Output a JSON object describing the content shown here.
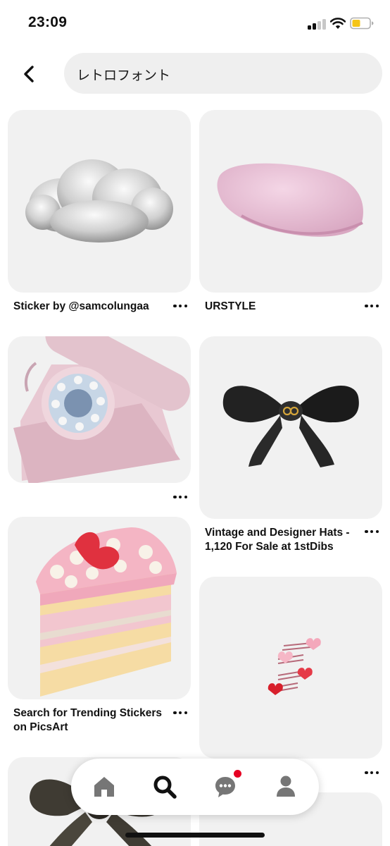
{
  "status": {
    "time": "23:09",
    "battery_color": "#f5c518"
  },
  "search": {
    "query": "レトロフォント"
  },
  "pins": [
    {
      "title": "Sticker by @samcolungaa",
      "image": "cloud"
    },
    {
      "title": "URSTYLE",
      "image": "pink-beret"
    },
    {
      "title": "",
      "image": "pink-rotary-phone"
    },
    {
      "title": "Vintage and Designer Hats - 1,120 For Sale at 1stDibs",
      "image": "black-bow"
    },
    {
      "title": "Search for Trending Stickers on PicsArt",
      "image": "pink-cake-slice"
    },
    {
      "title": "",
      "image": "heart-hair-clips"
    },
    {
      "title": "",
      "image": "brown-ribbon-bow"
    },
    {
      "title": "",
      "image": ""
    }
  ],
  "nav": {
    "items": [
      {
        "icon": "home-icon",
        "active": false
      },
      {
        "icon": "search-icon",
        "active": true
      },
      {
        "icon": "chat-icon",
        "active": false,
        "notification_dot_color": "#e60023"
      },
      {
        "icon": "profile-icon",
        "active": false
      }
    ]
  }
}
